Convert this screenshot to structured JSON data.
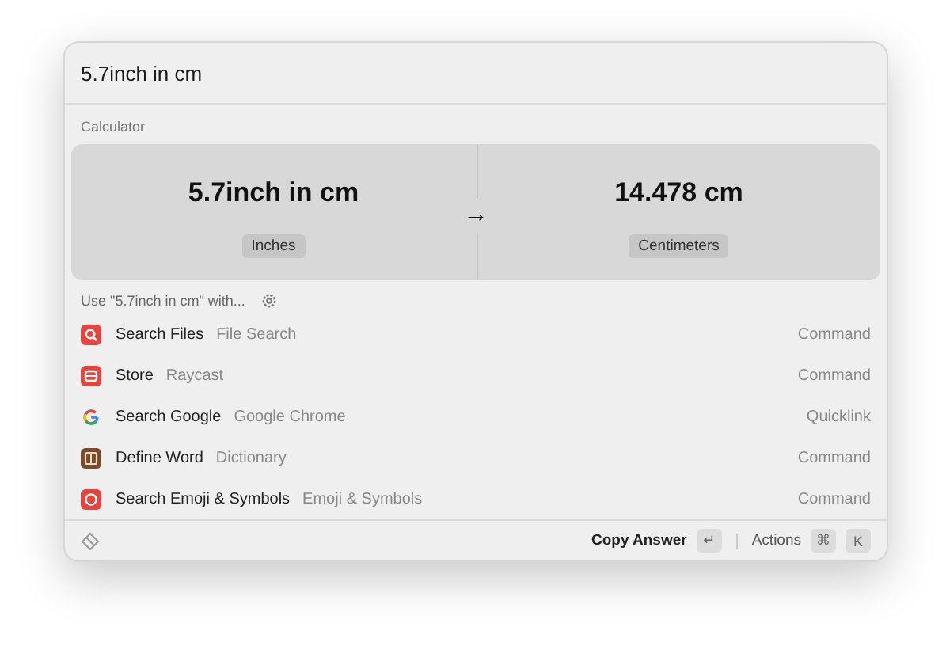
{
  "search": {
    "value": "5.7inch in cm"
  },
  "section_title": "Calculator",
  "calculator": {
    "expression": "5.7inch in cm",
    "from_unit": "Inches",
    "arrow": "→",
    "result": "14.478 cm",
    "to_unit": "Centimeters"
  },
  "fallback_title": "Use \"5.7inch in cm\" with...",
  "results": [
    {
      "kind": "search",
      "title": "Search Files",
      "subtitle": "File Search",
      "type": "Command"
    },
    {
      "kind": "store",
      "title": "Store",
      "subtitle": "Raycast",
      "type": "Command"
    },
    {
      "kind": "google",
      "title": "Search Google",
      "subtitle": "Google Chrome",
      "type": "Quicklink"
    },
    {
      "kind": "book",
      "title": "Define Word",
      "subtitle": "Dictionary",
      "type": "Command"
    },
    {
      "kind": "emoji",
      "title": "Search Emoji & Symbols",
      "subtitle": "Emoji & Symbols",
      "type": "Command"
    }
  ],
  "footer": {
    "primary_action": "Copy Answer",
    "primary_key": "↵",
    "actions_label": "Actions",
    "keys": [
      "⌘",
      "K"
    ]
  }
}
